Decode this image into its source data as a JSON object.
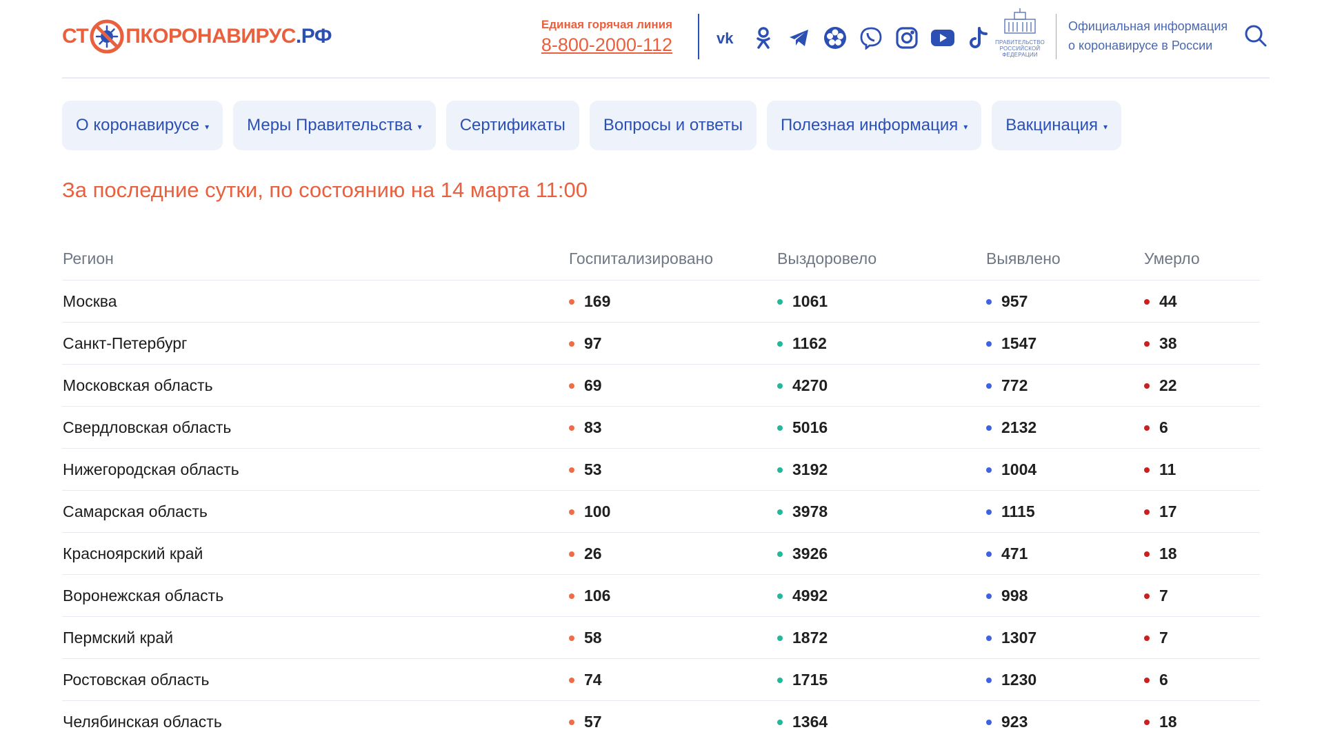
{
  "header": {
    "logo": {
      "part1": "СТ",
      "part2": "ПКОРОНАВИРУС",
      "part3": ".РФ"
    },
    "hotline_label": "Единая горячая линия",
    "hotline_phone": "8-800-2000-112",
    "gov_emblem_text": "ПРАВИТЕЛЬСТВО РОССИЙСКОЙ ФЕДЕРАЦИИ",
    "official_line1": "Официальная информация",
    "official_line2": "о коронавирусе в России",
    "socials": [
      "vk-icon",
      "odnoklassniki-icon",
      "telegram-icon",
      "yappy-icon",
      "viber-icon",
      "instagram-icon",
      "youtube-icon",
      "tiktok-icon"
    ]
  },
  "nav": [
    {
      "label": "О коронавирусе",
      "dropdown": true
    },
    {
      "label": "Меры Правительства",
      "dropdown": true
    },
    {
      "label": "Сертификаты",
      "dropdown": false
    },
    {
      "label": "Вопросы и ответы",
      "dropdown": false
    },
    {
      "label": "Полезная информация",
      "dropdown": true
    },
    {
      "label": "Вакцинация",
      "dropdown": true
    }
  ],
  "caret": "▾",
  "date_heading": "За последние сутки, по состоянию на 14 марта 11:00",
  "table": {
    "columns": [
      "Регион",
      "Госпитализировано",
      "Выздоровело",
      "Выявлено",
      "Умерло"
    ],
    "rows": [
      {
        "region": "Москва",
        "hospitalized": "169",
        "recovered": "1061",
        "detected": "957",
        "died": "44"
      },
      {
        "region": "Санкт-Петербург",
        "hospitalized": "97",
        "recovered": "1162",
        "detected": "1547",
        "died": "38"
      },
      {
        "region": "Московская область",
        "hospitalized": "69",
        "recovered": "4270",
        "detected": "772",
        "died": "22"
      },
      {
        "region": "Свердловская область",
        "hospitalized": "83",
        "recovered": "5016",
        "detected": "2132",
        "died": "6"
      },
      {
        "region": "Нижегородская область",
        "hospitalized": "53",
        "recovered": "3192",
        "detected": "1004",
        "died": "11"
      },
      {
        "region": "Самарская область",
        "hospitalized": "100",
        "recovered": "3978",
        "detected": "1115",
        "died": "17"
      },
      {
        "region": "Красноярский край",
        "hospitalized": "26",
        "recovered": "3926",
        "detected": "471",
        "died": "18"
      },
      {
        "region": "Воронежская область",
        "hospitalized": "106",
        "recovered": "4992",
        "detected": "998",
        "died": "7"
      },
      {
        "region": "Пермский край",
        "hospitalized": "58",
        "recovered": "1872",
        "detected": "1307",
        "died": "7"
      },
      {
        "region": "Ростовская область",
        "hospitalized": "74",
        "recovered": "1715",
        "detected": "1230",
        "died": "6"
      },
      {
        "region": "Челябинская область",
        "hospitalized": "57",
        "recovered": "1364",
        "detected": "923",
        "died": "18"
      }
    ]
  },
  "colors": {
    "accent_red": "#e9603e",
    "brand_blue": "#2c4fb3",
    "hospitalized_dot": "#f06c47",
    "recovered_dot": "#25b79b",
    "detected_dot": "#3e63e0",
    "died_dot": "#cc1f1f"
  }
}
